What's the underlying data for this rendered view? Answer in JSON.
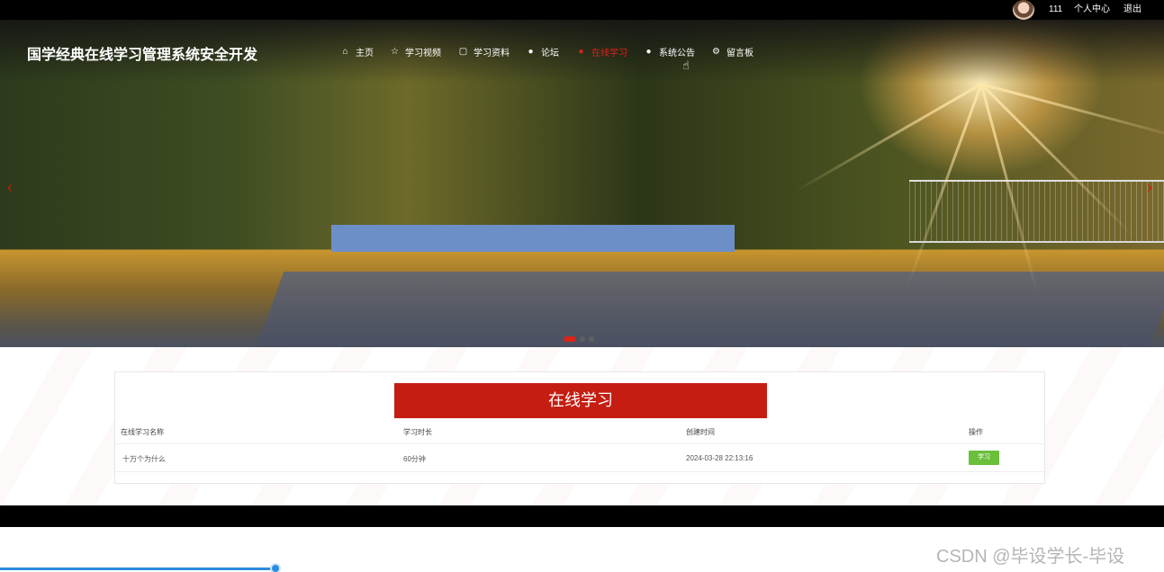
{
  "topbar": {
    "username": "111",
    "profile_label": "个人中心",
    "logout_label": "退出"
  },
  "header": {
    "title": "国学经典在线学习管理系统安全开发",
    "nav": [
      {
        "label": "主页",
        "icon": "home-icon",
        "active": false
      },
      {
        "label": "学习视频",
        "icon": "star-icon",
        "active": false
      },
      {
        "label": "学习资料",
        "icon": "bag-icon",
        "active": false
      },
      {
        "label": "论坛",
        "icon": "info-icon",
        "active": false
      },
      {
        "label": "在线学习",
        "icon": "info-icon",
        "active": true
      },
      {
        "label": "系统公告",
        "icon": "info-icon",
        "active": false
      },
      {
        "label": "留言板",
        "icon": "settings-icon",
        "active": false
      }
    ]
  },
  "carousel": {
    "prev_icon": "‹",
    "next_icon": "›",
    "slide_count": 3,
    "active_slide": 1
  },
  "section": {
    "title": "在线学习",
    "columns": [
      "在线学习名称",
      "学习时长",
      "创建时间",
      "操作"
    ],
    "rows": [
      {
        "name": "十万个为什么",
        "duration": "60分钟",
        "created": "2024-03-28 22:13:16",
        "action": "学习"
      }
    ]
  },
  "watermark": "CSDN @毕设学长-毕设",
  "colors": {
    "accent_red": "#c51d12",
    "active_nav": "#d9241b",
    "action_green": "#6abf3b",
    "progress_blue": "#2b8de0"
  }
}
